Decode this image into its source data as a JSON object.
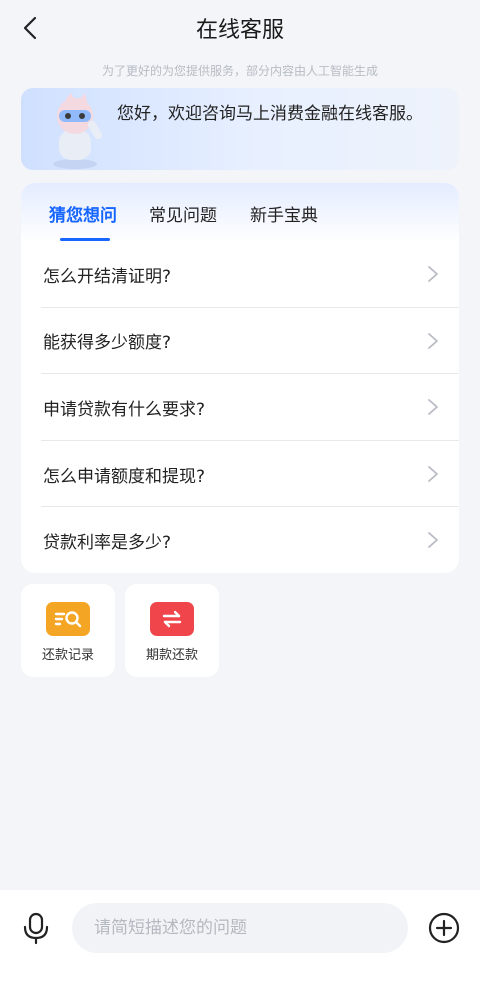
{
  "header": {
    "title": "在线客服",
    "subtitle": "为了更好的为您提供服务，部分内容由人工智能生成"
  },
  "welcome": {
    "message": "您好，欢迎咨询马上消费金融在线客服。"
  },
  "faq": {
    "tabs": [
      {
        "label": "猜您想问",
        "active": true
      },
      {
        "label": "常见问题",
        "active": false
      },
      {
        "label": "新手宝典",
        "active": false
      }
    ],
    "items": [
      {
        "label": "怎么开结清证明?"
      },
      {
        "label": "能获得多少额度?"
      },
      {
        "label": "申请贷款有什么要求?"
      },
      {
        "label": "怎么申请额度和提现?"
      },
      {
        "label": "贷款利率是多少?"
      }
    ]
  },
  "shortcuts": [
    {
      "label": "还款记录",
      "icon": "repayment-record-icon",
      "color": "#f5a524"
    },
    {
      "label": "期款还款",
      "icon": "installment-repay-icon",
      "color": "#f0454a"
    }
  ],
  "input": {
    "placeholder": "请简短描述您的问题",
    "value": ""
  },
  "colors": {
    "accent": "#1766ff",
    "background": "#f3f5f8"
  }
}
